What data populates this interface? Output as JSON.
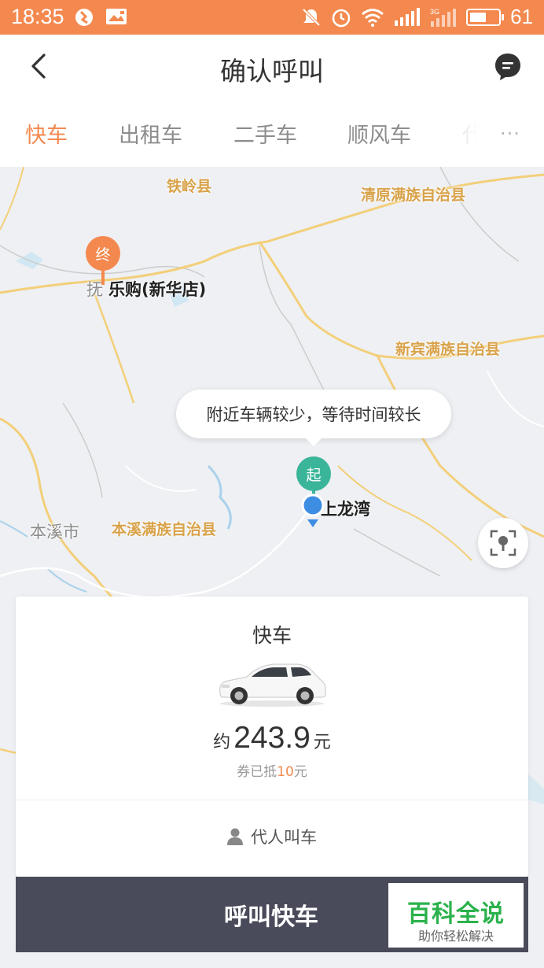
{
  "status_bar": {
    "time": "18:35",
    "battery": "61",
    "battery_level": 0.61,
    "network_label": "3G"
  },
  "header": {
    "title": "确认呼叫"
  },
  "tabs": {
    "items": [
      "快车",
      "出租车",
      "二手车",
      "顺风车"
    ],
    "partial": "代",
    "more": "···",
    "active_index": 0
  },
  "map": {
    "places": {
      "tieling": "铁岭县",
      "qingyuan": "清原满族自治县",
      "xinbin": "新宾满族自治县",
      "benxi_county": "本溪满族自治县",
      "benxi_city": "本溪市",
      "fushun_partial": "抚"
    },
    "destination": {
      "marker": "终",
      "label": "乐购(新华店)"
    },
    "origin": {
      "marker": "起",
      "label": "上龙湾"
    },
    "tooltip": "附近车辆较少，等待时间较长"
  },
  "card": {
    "title": "快车",
    "price_prefix": "约",
    "price": "243.9",
    "price_unit": "元",
    "coupon_prefix": "券已抵",
    "coupon_amount": "10",
    "coupon_unit": "元",
    "proxy_label": "代人叫车"
  },
  "call_button": "呼叫快车",
  "watermark": {
    "title": "百科全说",
    "subtitle": "助你轻松解决"
  },
  "colors": {
    "accent": "#f4894f",
    "origin_green": "#3bb59a",
    "location_blue": "#3d8de2",
    "button_dark": "#4a4b5a",
    "watermark_green": "#2bb24c"
  }
}
